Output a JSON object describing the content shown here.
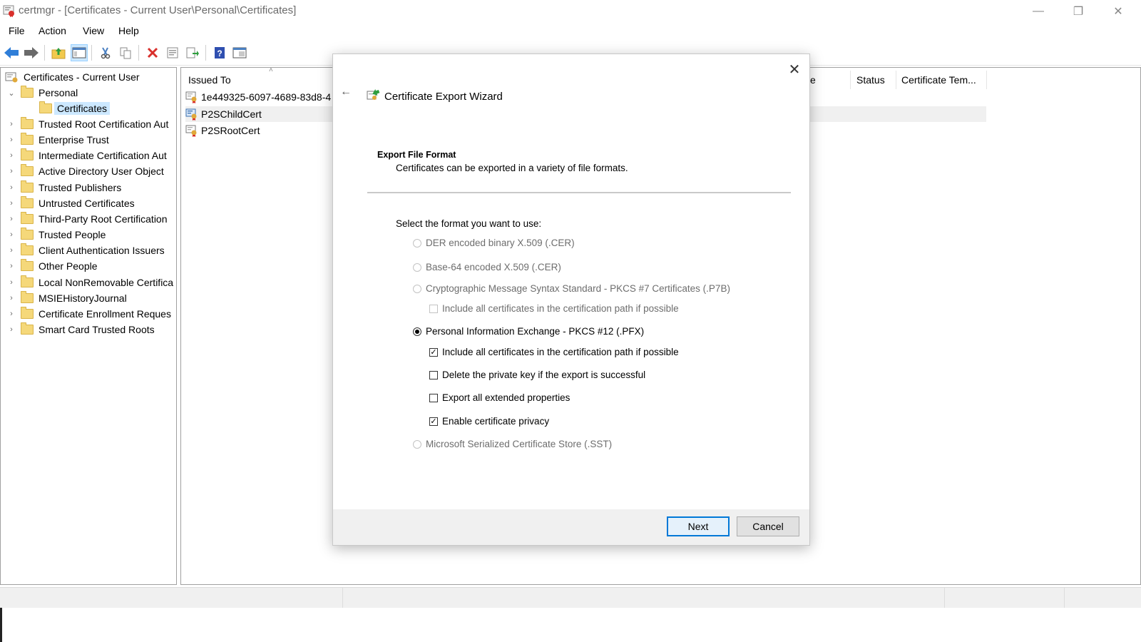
{
  "window": {
    "title": "certmgr - [Certificates - Current User\\Personal\\Certificates]",
    "minimize": "—",
    "restore": "❐",
    "close": "✕"
  },
  "menu": [
    "File",
    "Action",
    "View",
    "Help"
  ],
  "toolbar_icons": [
    "back-arrow-icon",
    "forward-arrow-icon",
    "up-folder-icon",
    "show-hide-console-tree-icon",
    "cut-icon",
    "copy-icon",
    "delete-icon",
    "properties-icon",
    "export-list-icon",
    "help-icon",
    "console-view-icon"
  ],
  "tree": {
    "root": "Certificates - Current User",
    "personal": "Personal",
    "certificates": "Certificates",
    "stores": [
      "Trusted Root Certification Aut",
      "Enterprise Trust",
      "Intermediate Certification Aut",
      "Active Directory User Object",
      "Trusted Publishers",
      "Untrusted Certificates",
      "Third-Party Root Certification",
      "Trusted People",
      "Client Authentication Issuers",
      "Other People",
      "Local NonRemovable Certifica",
      "MSIEHistoryJournal",
      "Certificate Enrollment Reques",
      "Smart Card Trusted Roots"
    ]
  },
  "list": {
    "columns": {
      "issued_to": "Issued To",
      "partial": "e",
      "status": "Status",
      "template": "Certificate Tem..."
    },
    "rows": [
      "1e449325-6097-4689-83d8-4",
      "P2SChildCert",
      "P2SRootCert"
    ]
  },
  "dialog": {
    "title": "Certificate Export Wizard",
    "close": "✕",
    "back": "←",
    "header_title": "Export File Format",
    "header_desc": "Certificates can be exported in a variety of file formats.",
    "prompt": "Select the format you want to use:",
    "options": {
      "der": "DER encoded binary X.509 (.CER)",
      "base64": "Base-64 encoded X.509 (.CER)",
      "pkcs7": "Cryptographic Message Syntax Standard - PKCS #7 Certificates (.P7B)",
      "pkcs7_include": "Include all certificates in the certification path if possible",
      "pfx": "Personal Information Exchange - PKCS #12 (.PFX)",
      "pfx_include": "Include all certificates in the certification path if possible",
      "pfx_delete_key": "Delete the private key if the export is successful",
      "pfx_extended": "Export all extended properties",
      "pfx_privacy": "Enable certificate privacy",
      "sst": "Microsoft Serialized Certificate Store (.SST)"
    },
    "checked_mark": "✓",
    "next": "Next",
    "cancel": "Cancel"
  }
}
